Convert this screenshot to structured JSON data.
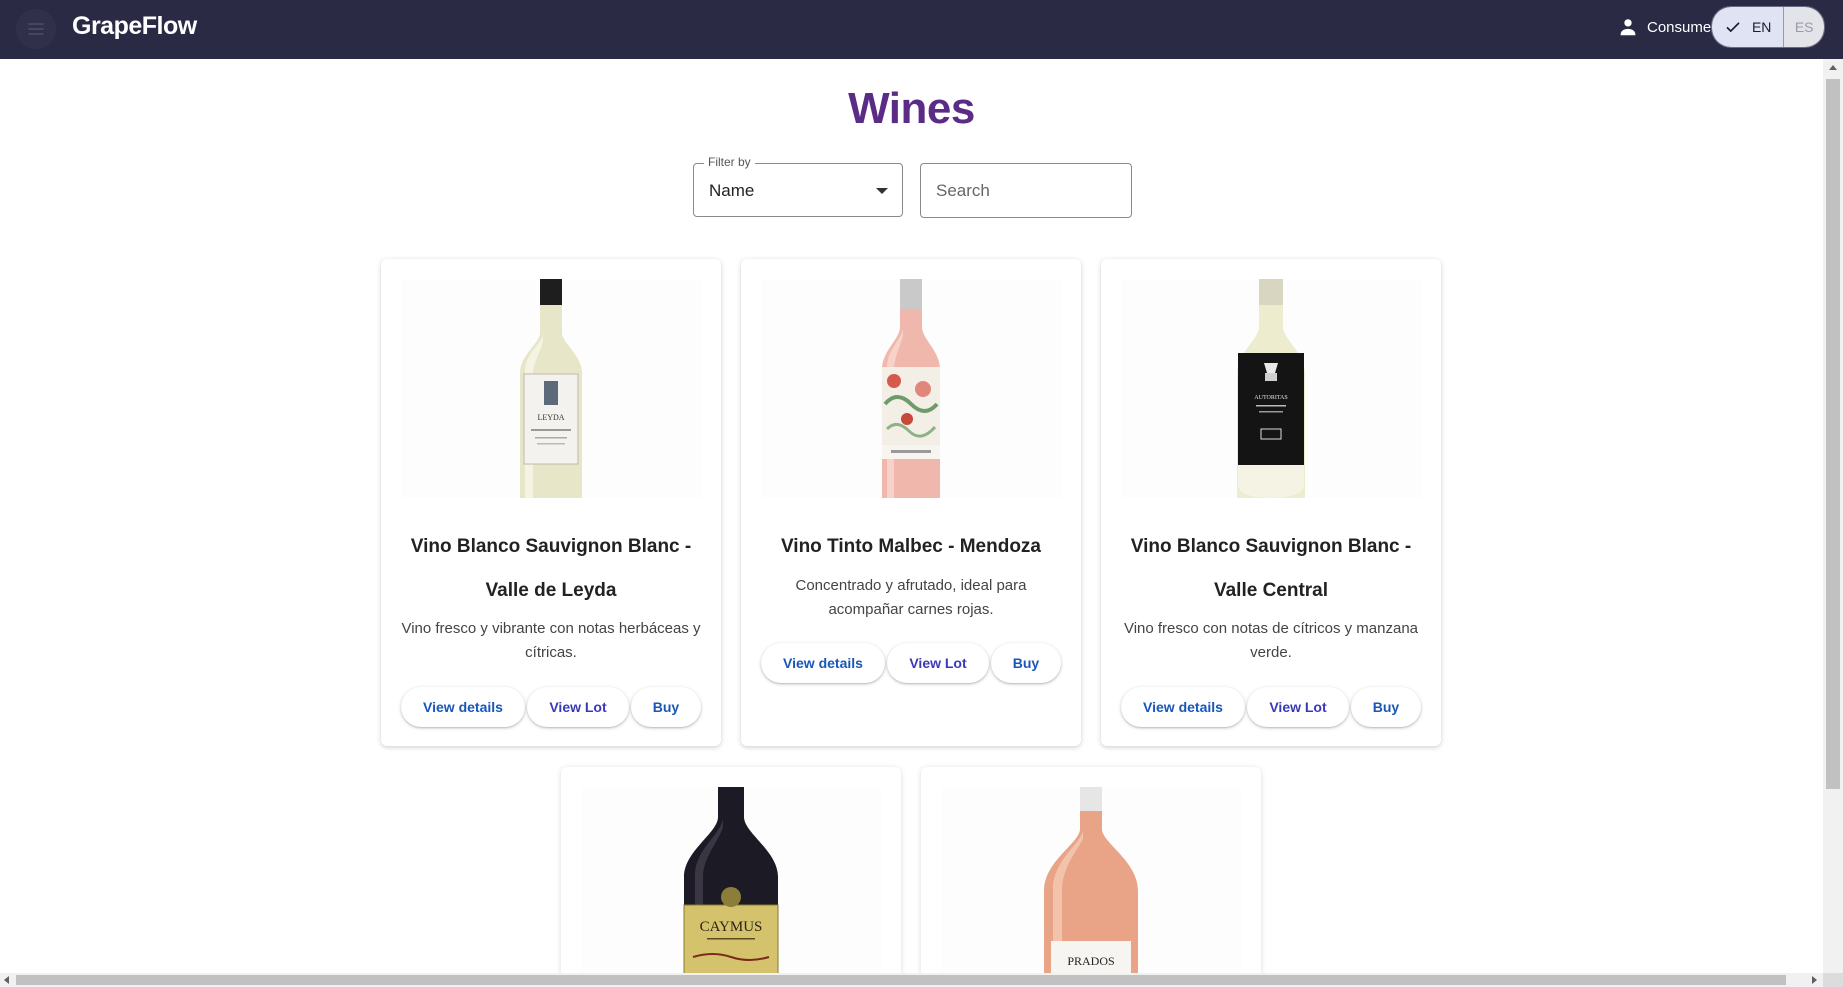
{
  "header": {
    "menu_icon": "hamburger-menu-icon",
    "brand": "GrapeFlow",
    "user_icon": "person-icon",
    "user_label": "Consumer",
    "languages": [
      {
        "code": "EN",
        "selected": true,
        "icon": "check-icon"
      },
      {
        "code": "ES",
        "selected": false
      }
    ]
  },
  "page": {
    "title": "Wines",
    "filter": {
      "legend": "Filter by",
      "selected": "Name"
    },
    "search": {
      "placeholder": "Search",
      "value": ""
    }
  },
  "colors": {
    "topbar": "#2a2a45",
    "title": "#5b2c86",
    "button_text": "#1857b8"
  },
  "wines": [
    {
      "name": "Vino Blanco Sauvignon Blanc - Valle de Leyda",
      "description": "Vino fresco y vibrante con notas herbáceas y cítricas.",
      "image": "white-wine-bottle-leyda",
      "label_text": "LEYDA",
      "actions": {
        "details": "View details",
        "lot": "View Lot",
        "buy": "Buy"
      }
    },
    {
      "name": "Vino Tinto Malbec - Mendoza",
      "description": "Concentrado y afrutado, ideal para acompañar carnes rojas.",
      "image": "rose-wine-bottle-floral",
      "actions": {
        "details": "View details",
        "lot": "View Lot",
        "buy": "Buy"
      }
    },
    {
      "name": "Vino Blanco Sauvignon Blanc - Valle Central",
      "description": "Vino fresco con notas de cítricos y manzana verde.",
      "image": "white-wine-bottle-black-label",
      "label_text": "AUTORITAS",
      "actions": {
        "details": "View details",
        "lot": "View Lot",
        "buy": "Buy"
      }
    },
    {
      "image": "red-wine-bottle-caymus",
      "label_text": "CAYMUS"
    },
    {
      "image": "rose-wine-bottle-prados",
      "label_text": "PRADOS"
    }
  ]
}
